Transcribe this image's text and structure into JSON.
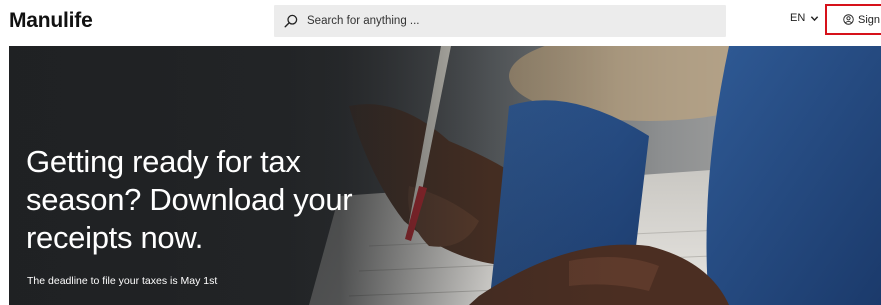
{
  "header": {
    "logo": "Manulife",
    "search_placeholder": "Search for anything ...",
    "language": "EN",
    "sign_in": "Sign in"
  },
  "hero": {
    "title": "Getting ready for tax season? Download your receipts now.",
    "subtitle": "The deadline to file your taxes is May 1st"
  },
  "colors": {
    "accent_border": "#d6111a",
    "search_bg": "#ececec",
    "hero_text": "#ffffff"
  },
  "icons": {
    "search": "search-icon",
    "language_dropdown": "chevron-down-icon",
    "sign_in": "user-icon"
  }
}
